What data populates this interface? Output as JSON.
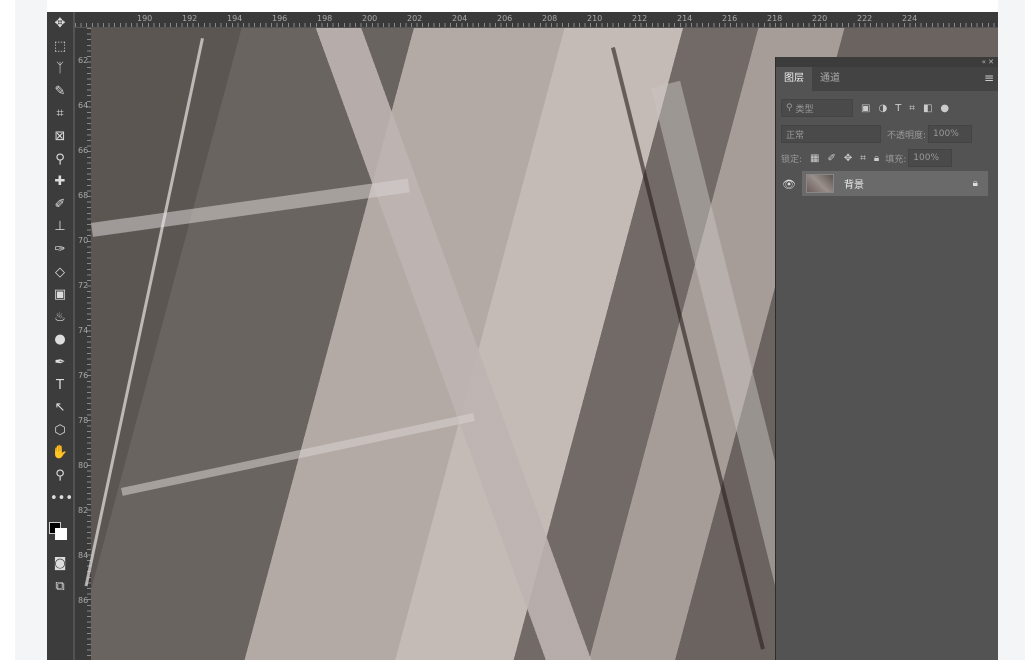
{
  "rulers": {
    "top": [
      "190",
      "192",
      "194",
      "196",
      "198",
      "200",
      "202",
      "204",
      "206",
      "208",
      "210",
      "212",
      "214",
      "216",
      "218",
      "220",
      "222",
      "224"
    ],
    "left": [
      "62",
      "64",
      "66",
      "68",
      "70",
      "72",
      "74",
      "76",
      "78",
      "80",
      "82",
      "84",
      "86"
    ]
  },
  "toolbar": {
    "tools": [
      {
        "name": "move-tool",
        "glyph": "✥"
      },
      {
        "name": "marquee-tool",
        "glyph": "⬚"
      },
      {
        "name": "lasso-tool",
        "glyph": "ᛉ"
      },
      {
        "name": "magic-wand-tool",
        "glyph": "✎"
      },
      {
        "name": "crop-tool",
        "glyph": "⌗"
      },
      {
        "name": "frame-tool",
        "glyph": "⊠"
      },
      {
        "name": "eyedropper-tool",
        "glyph": "⚲"
      },
      {
        "name": "healing-tool",
        "glyph": "✚"
      },
      {
        "name": "brush-tool",
        "glyph": "✐"
      },
      {
        "name": "stamp-tool",
        "glyph": "⊥"
      },
      {
        "name": "history-brush-tool",
        "glyph": "✑"
      },
      {
        "name": "eraser-tool",
        "glyph": "◇"
      },
      {
        "name": "gradient-tool",
        "glyph": "▣"
      },
      {
        "name": "blur-tool",
        "glyph": "♨"
      },
      {
        "name": "dodge-tool",
        "glyph": "●"
      },
      {
        "name": "pen-tool",
        "glyph": "✒"
      },
      {
        "name": "type-tool",
        "glyph": "T"
      },
      {
        "name": "path-select-tool",
        "glyph": "↖"
      },
      {
        "name": "shape-tool",
        "glyph": "⬡"
      },
      {
        "name": "hand-tool",
        "glyph": "✋"
      },
      {
        "name": "zoom-tool",
        "glyph": "⚲"
      },
      {
        "name": "more-tools",
        "glyph": "•••"
      }
    ]
  },
  "panel": {
    "tabs": [
      "图层",
      "通道"
    ],
    "filter_placeholder": "类型",
    "blend_mode": "正常",
    "opacity_label": "不透明度:",
    "opacity": "100%",
    "lock_label": "锁定:",
    "fill_label": "填充:",
    "fill": "100%",
    "layers": [
      {
        "name": "背景",
        "visible": true,
        "locked": true
      }
    ]
  }
}
